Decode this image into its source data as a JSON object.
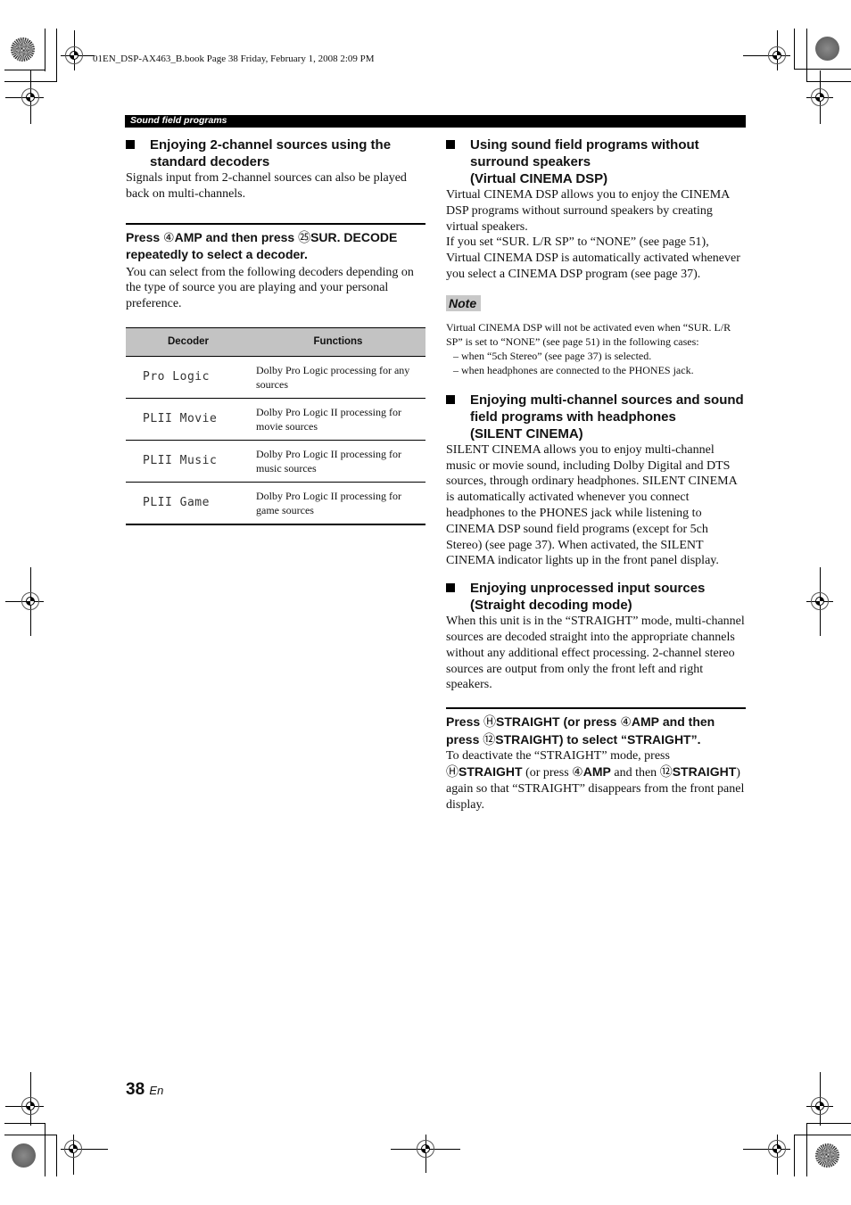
{
  "print_header": "01EN_DSP-AX463_B.book  Page 38  Friday, February 1, 2008  2:09 PM",
  "section_label": "Sound field programs",
  "left_column": {
    "heading": "Enjoying 2-channel sources using the standard decoders",
    "intro": "Signals input from 2-channel sources can also be played back on multi-channels.",
    "step": {
      "press": "Press ",
      "key1_num": "④",
      "key1": "AMP",
      "middle": " and then press ",
      "key2_num": "㉕",
      "key2": "SUR. DECODE",
      "end": " repeatedly to select a decoder."
    },
    "step_desc": "You can select from the following decoders depending on the type of source you are playing and your personal preference.",
    "table": {
      "headers": [
        "Decoder",
        "Functions"
      ],
      "rows": [
        {
          "decoder": "Pro Logic",
          "function": "Dolby Pro Logic processing for any sources"
        },
        {
          "decoder": "PLII Movie",
          "function": "Dolby Pro Logic II processing for movie sources"
        },
        {
          "decoder": "PLII Music",
          "function": "Dolby Pro Logic II processing for music sources"
        },
        {
          "decoder": "PLII Game",
          "function": "Dolby Pro Logic II processing for game sources"
        }
      ]
    }
  },
  "right_column": {
    "virtual": {
      "heading_line1": "Using sound field programs without surround speakers",
      "heading_line2": "(Virtual CINEMA DSP)",
      "para1": "Virtual CINEMA DSP allows you to enjoy the CINEMA DSP programs without surround speakers by creating virtual speakers.",
      "para2": "If you set “SUR. L/R SP” to “NONE” (see page 51), Virtual CINEMA DSP is automatically activated whenever you select a CINEMA DSP program (see page 37)."
    },
    "note": {
      "label": "Note",
      "text": "Virtual CINEMA DSP will not be activated even when “SUR. L/R SP” is set to “NONE” (see page 51) in the following cases:",
      "items": [
        "– when “5ch Stereo” (see page 37) is selected.",
        "– when headphones are connected to the PHONES jack."
      ]
    },
    "silent": {
      "heading_line1": "Enjoying multi-channel sources and sound field programs with headphones",
      "heading_line2": "(SILENT CINEMA)",
      "para": "SILENT CINEMA allows you to enjoy multi-channel music or movie sound, including Dolby Digital and DTS sources, through ordinary headphones. SILENT CINEMA is automatically activated whenever you connect headphones to the PHONES jack while listening to CINEMA DSP sound field programs (except for 5ch Stereo) (see page 37). When activated, the SILENT CINEMA indicator lights up in the front panel display."
    },
    "straight": {
      "heading_line1": "Enjoying unprocessed input sources",
      "heading_line2": "(Straight decoding mode)",
      "para": "When this unit is in the “STRAIGHT” mode, multi-channel sources are decoded straight into the appropriate channels without any additional effect processing. 2-channel stereo sources are output from only the front left and right speakers.",
      "step": {
        "press": "Press ",
        "keyH_num": "Ⓗ",
        "keyH": "STRAIGHT",
        "or_press": " (or press ",
        "key4_num": "④",
        "key4": "AMP",
        "and_then": " and then press ",
        "key12_num": "⑫",
        "key12": "STRAIGHT",
        "end": ") to select “STRAIGHT”."
      },
      "deactivate": {
        "t1": "To deactivate the “STRAIGHT” mode, press ",
        "keyH_num": "Ⓗ",
        "keyH": "STRAIGHT",
        "t2": " (or press ",
        "key4_num": "④",
        "key4": "AMP",
        "t3": " and then ",
        "key12_num": "⑫",
        "key12": "STRAIGHT",
        "t4": ") again so that “STRAIGHT” disappears from the front panel display."
      }
    }
  },
  "footer": {
    "page_number": "38",
    "language": "En"
  }
}
